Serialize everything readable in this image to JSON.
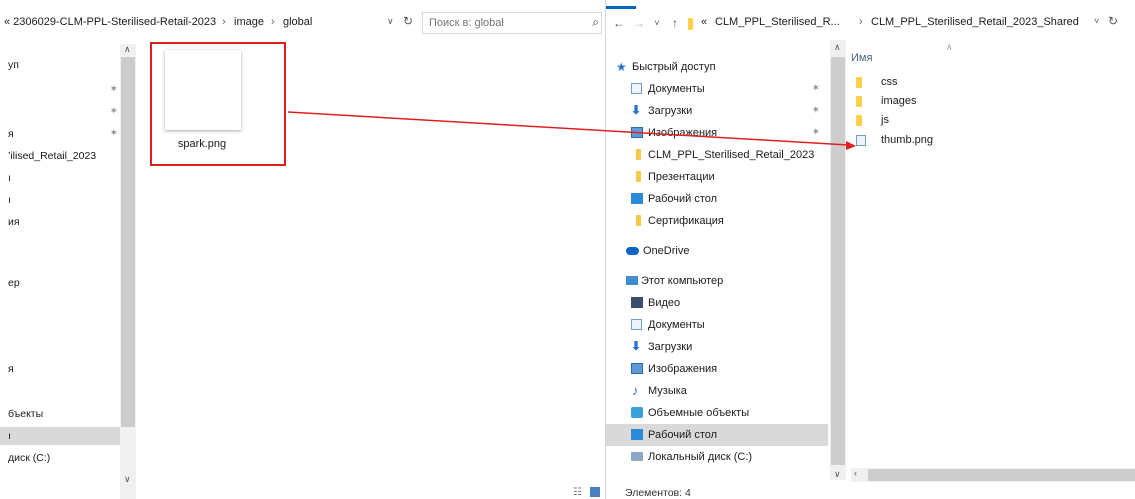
{
  "left": {
    "breadcrumb": [
      "« 2306029-CLM-PPL-Sterilised-Retail-2023",
      "image",
      "global"
    ],
    "breadcrumb_sep": "›",
    "search_placeholder": "Поиск в: global",
    "nav_items": [
      "уп",
      "",
      "",
      "я",
      "’ilised_Retail_2023",
      "ı",
      "ı",
      "ия",
      "",
      "",
      "ер",
      "",
      "",
      "",
      "",
      "я",
      "",
      "",
      "бъекты",
      "ı",
      "диск (C:)"
    ],
    "file": {
      "name": "spark.png"
    }
  },
  "right": {
    "breadcrumb": [
      "«",
      "CLM_PPL_Sterilised_R...",
      "CLM_PPL_Sterilised_Retail_2023_Shared"
    ],
    "breadcrumb_sep": "›",
    "nav": {
      "back": "←",
      "forward": "→",
      "recent": "˅",
      "up": "↑",
      "dropdown": "˅",
      "refresh": "↻"
    },
    "tree": [
      {
        "label": "Быстрый доступ",
        "icon": "star-icon"
      },
      {
        "label": "Документы",
        "icon": "documents-icon",
        "pinned": true
      },
      {
        "label": "Загрузки",
        "icon": "download-icon",
        "pinned": true
      },
      {
        "label": "Изображения",
        "icon": "pictures-icon",
        "pinned": true
      },
      {
        "label": "CLM_PPL_Sterilised_Retail_2023",
        "icon": "folder-icon"
      },
      {
        "label": "Презентации",
        "icon": "folder-icon"
      },
      {
        "label": "Рабочий стол",
        "icon": "desktop-icon"
      },
      {
        "label": "Сертификация",
        "icon": "folder-icon"
      },
      {
        "label": "OneDrive",
        "icon": "onedrive-icon"
      },
      {
        "label": "Этот компьютер",
        "icon": "computer-icon"
      },
      {
        "label": "Видео",
        "icon": "video-icon"
      },
      {
        "label": "Документы",
        "icon": "documents-icon"
      },
      {
        "label": "Загрузки",
        "icon": "download-icon"
      },
      {
        "label": "Изображения",
        "icon": "pictures-icon"
      },
      {
        "label": "Музыка",
        "icon": "music-icon"
      },
      {
        "label": "Объемные объекты",
        "icon": "3d-objects-icon"
      },
      {
        "label": "Рабочий стол",
        "icon": "desktop-icon",
        "selected": true
      },
      {
        "label": "Локальный диск (C:)",
        "icon": "drive-icon"
      }
    ],
    "column_name": "Имя",
    "files": [
      {
        "name": "css",
        "icon": "folder-icon"
      },
      {
        "name": "images",
        "icon": "folder-icon"
      },
      {
        "name": "js",
        "icon": "folder-icon"
      },
      {
        "name": "thumb.png",
        "icon": "image-file-icon"
      }
    ],
    "status": "Элементов: 4"
  },
  "colors": {
    "highlight_box": "#e02020",
    "arrow": "#e02020",
    "selection": "#d9d9d9",
    "folder": "#ffcf48",
    "accent": "#0067c0"
  }
}
